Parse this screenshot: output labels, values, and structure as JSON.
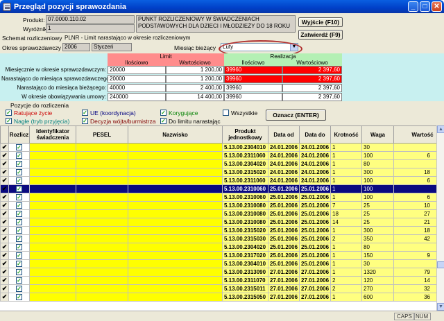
{
  "window": {
    "title": "Przegląd pozycji sprawozdania",
    "min": "_",
    "max": "□",
    "close": "✕"
  },
  "header": {
    "produkt_label": "Produkt:",
    "produkt_value": "07.0000.110.02",
    "wyroznik_label": "Wyróżnik",
    "wyroznik_value": "1",
    "product_desc": "PUNKT ROZLICZENIOWY W ŚWIADCZENIACH PODSTAWOWYCH DLA DZIECI I MŁODZIEŻY DO 18 ROKU",
    "schemat_label": "Schemat rozliczeniowy:",
    "schemat_value": "PLNR - Limit narastająco w okresie rozliczeniowym",
    "okres_label": "Okres sprawozdawczy",
    "okres_year": "2006",
    "okres_month": "Styczeń",
    "miesiac_label": "Miesiąc bieżący",
    "miesiac_value": "Luty",
    "wyjscie": "Wyjście (F10)",
    "zatwierdz": "Zatwierdź (F9)"
  },
  "limits": {
    "limit_header": "Limit",
    "realizacja_header": "Realizacja",
    "ilosciowo": "Ilościowo",
    "wartosciowo": "Wartościowo",
    "rows": [
      {
        "label": "Miesięcznie w okresie sprawozdawczym:",
        "li": "20000",
        "lw": "1 200,00",
        "ri": "39960",
        "rw": "2 397,60",
        "red": true
      },
      {
        "label": "Narastająco do miesiąca sprawozdawczego:",
        "li": "20000",
        "lw": "1 200,00",
        "ri": "39960",
        "rw": "2 397,60",
        "red": true
      },
      {
        "label": "Narastająco do miesiąca bieżącego:",
        "li": "40000",
        "lw": "2 400,00",
        "ri": "39960",
        "rw": "2 397,60",
        "red": false
      },
      {
        "label": "W okresie obowiązywania umowy:",
        "li": "240000",
        "lw": "14 400,00",
        "ri": "39960",
        "rw": "2 397,60",
        "red": false
      }
    ]
  },
  "filters": {
    "title": "Pozycje do rozliczenia",
    "ratujace": "Ratujące życie",
    "nagle": "Nagłe (tryb przyjęcia)",
    "ue": "UE (koordynacja)",
    "decyzja": "Decyzja wójta/burmistrza",
    "korygujace": "Korygujące",
    "do_limitu": "Do limitu narastając",
    "wszystkie": "Wszystkie",
    "oznacz": "Oznacz (ENTER)",
    "colors": {
      "ratujace": "#cc0000",
      "nagle": "#008080",
      "ue": "#000080",
      "decyzja": "#800000",
      "korygujace": "#008000"
    }
  },
  "grid": {
    "headers": [
      "Rozlicz",
      "Identyfikator świadczenia",
      "PESEL",
      "Nazwisko",
      "Produkt jednostkowy",
      "Data od",
      "Data do",
      "Krotność",
      "Waga",
      "Wartość"
    ],
    "rows": [
      {
        "produkt": "5.13.00.2304010",
        "od": "24.01.2006",
        "do": "24.01.2006",
        "krot": "1",
        "waga": "30",
        "wart": ""
      },
      {
        "produkt": "5.13.00.2311060",
        "od": "24.01.2006",
        "do": "24.01.2006",
        "krot": "1",
        "waga": "100",
        "wart": "6"
      },
      {
        "produkt": "5.13.00.2304020",
        "od": "24.01.2006",
        "do": "24.01.2006",
        "krot": "1",
        "waga": "80",
        "wart": ""
      },
      {
        "produkt": "5.13.00.2315020",
        "od": "24.01.2006",
        "do": "24.01.2006",
        "krot": "1",
        "waga": "300",
        "wart": "18"
      },
      {
        "produkt": "5.13.00.2311060",
        "od": "24.01.2006",
        "do": "24.01.2006",
        "krot": "1",
        "waga": "100",
        "wart": "6"
      },
      {
        "produkt": "5.13.00.2310060",
        "od": "25.01.2006",
        "do": "25.01.2006",
        "krot": "1",
        "waga": "100",
        "wart": "",
        "selected": true
      },
      {
        "produkt": "5.13.00.2310060",
        "od": "25.01.2006",
        "do": "25.01.2006",
        "krot": "1",
        "waga": "100",
        "wart": "6"
      },
      {
        "produkt": "5.13.00.2310080",
        "od": "25.01.2006",
        "do": "25.01.2006",
        "krot": "7",
        "waga": "25",
        "wart": "10"
      },
      {
        "produkt": "5.13.00.2310080",
        "od": "25.01.2006",
        "do": "25.01.2006",
        "krot": "18",
        "waga": "25",
        "wart": "27"
      },
      {
        "produkt": "5.13.00.2310080",
        "od": "25.01.2006",
        "do": "25.01.2006",
        "krot": "14",
        "waga": "25",
        "wart": "21"
      },
      {
        "produkt": "5.13.00.2315020",
        "od": "25.01.2006",
        "do": "25.01.2006",
        "krot": "1",
        "waga": "300",
        "wart": "18"
      },
      {
        "produkt": "5.13.00.2315030",
        "od": "25.01.2006",
        "do": "25.01.2006",
        "krot": "2",
        "waga": "350",
        "wart": "42"
      },
      {
        "produkt": "5.13.00.2304020",
        "od": "25.01.2006",
        "do": "25.01.2006",
        "krot": "1",
        "waga": "80",
        "wart": ""
      },
      {
        "produkt": "5.13.00.2317020",
        "od": "25.01.2006",
        "do": "25.01.2006",
        "krot": "1",
        "waga": "150",
        "wart": "9"
      },
      {
        "produkt": "5.13.00.2304010",
        "od": "25.01.2006",
        "do": "25.01.2006",
        "krot": "1",
        "waga": "30",
        "wart": ""
      },
      {
        "produkt": "5.13.00.2313090",
        "od": "27.01.2006",
        "do": "27.01.2006",
        "krot": "1",
        "waga": "1320",
        "wart": "79"
      },
      {
        "produkt": "5.13.00.2311070",
        "od": "27.01.2006",
        "do": "27.01.2006",
        "krot": "2",
        "waga": "120",
        "wart": "14"
      },
      {
        "produkt": "5.13.00.2315011",
        "od": "27.01.2006",
        "do": "27.01.2006",
        "krot": "2",
        "waga": "270",
        "wart": "32"
      },
      {
        "produkt": "5.13.00.2315050",
        "od": "27.01.2006",
        "do": "27.01.2006",
        "krot": "1",
        "waga": "600",
        "wart": "36"
      }
    ]
  },
  "status": {
    "caps": "CAPS",
    "num": "NUM"
  }
}
